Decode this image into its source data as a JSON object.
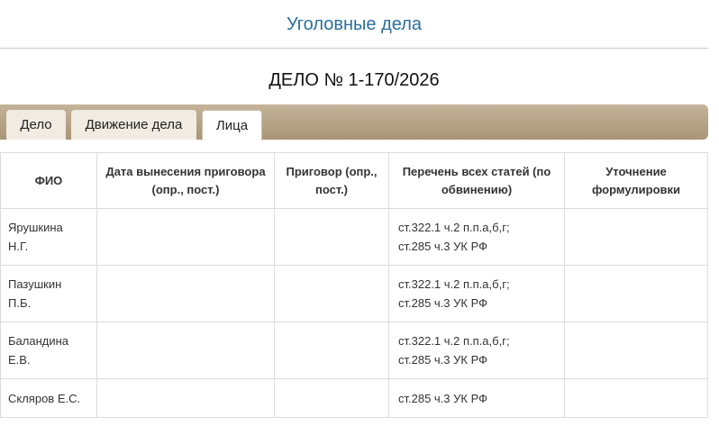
{
  "header": {
    "title": "Уголовные дела"
  },
  "case": {
    "title": "ДЕЛО № 1-170/2026"
  },
  "tabs": [
    {
      "label": "Дело",
      "active": false
    },
    {
      "label": "Движение дела",
      "active": false
    },
    {
      "label": "Лица",
      "active": true
    }
  ],
  "table": {
    "headers": [
      "ФИО",
      "Дата вынесения приговора (опр., пост.)",
      "Приговор (опр., пост.)",
      "Перечень всех статей (по обвинению)",
      "Уточнение формулировки"
    ],
    "rows": [
      {
        "name": "Ярушкина Н.Г.",
        "date": "",
        "verdict": "",
        "articles": "ст.322.1 ч.2 п.п.а,б,г; ст.285 ч.3 УК РФ",
        "clarification": ""
      },
      {
        "name": "Пазушкин П.Б.",
        "date": "",
        "verdict": "",
        "articles": "ст.322.1 ч.2 п.п.а,б,г; ст.285 ч.3 УК РФ",
        "clarification": ""
      },
      {
        "name": "Баландина Е.В.",
        "date": "",
        "verdict": "",
        "articles": "ст.322.1 ч.2 п.п.а,б,г; ст.285 ч.3 УК РФ",
        "clarification": ""
      },
      {
        "name": "Скляров Е.С.",
        "date": "",
        "verdict": "",
        "articles": "ст.285 ч.3 УК РФ",
        "clarification": ""
      }
    ]
  },
  "colors": {
    "title_blue": "#2a6f9e",
    "tabbar": "#b3a184"
  }
}
